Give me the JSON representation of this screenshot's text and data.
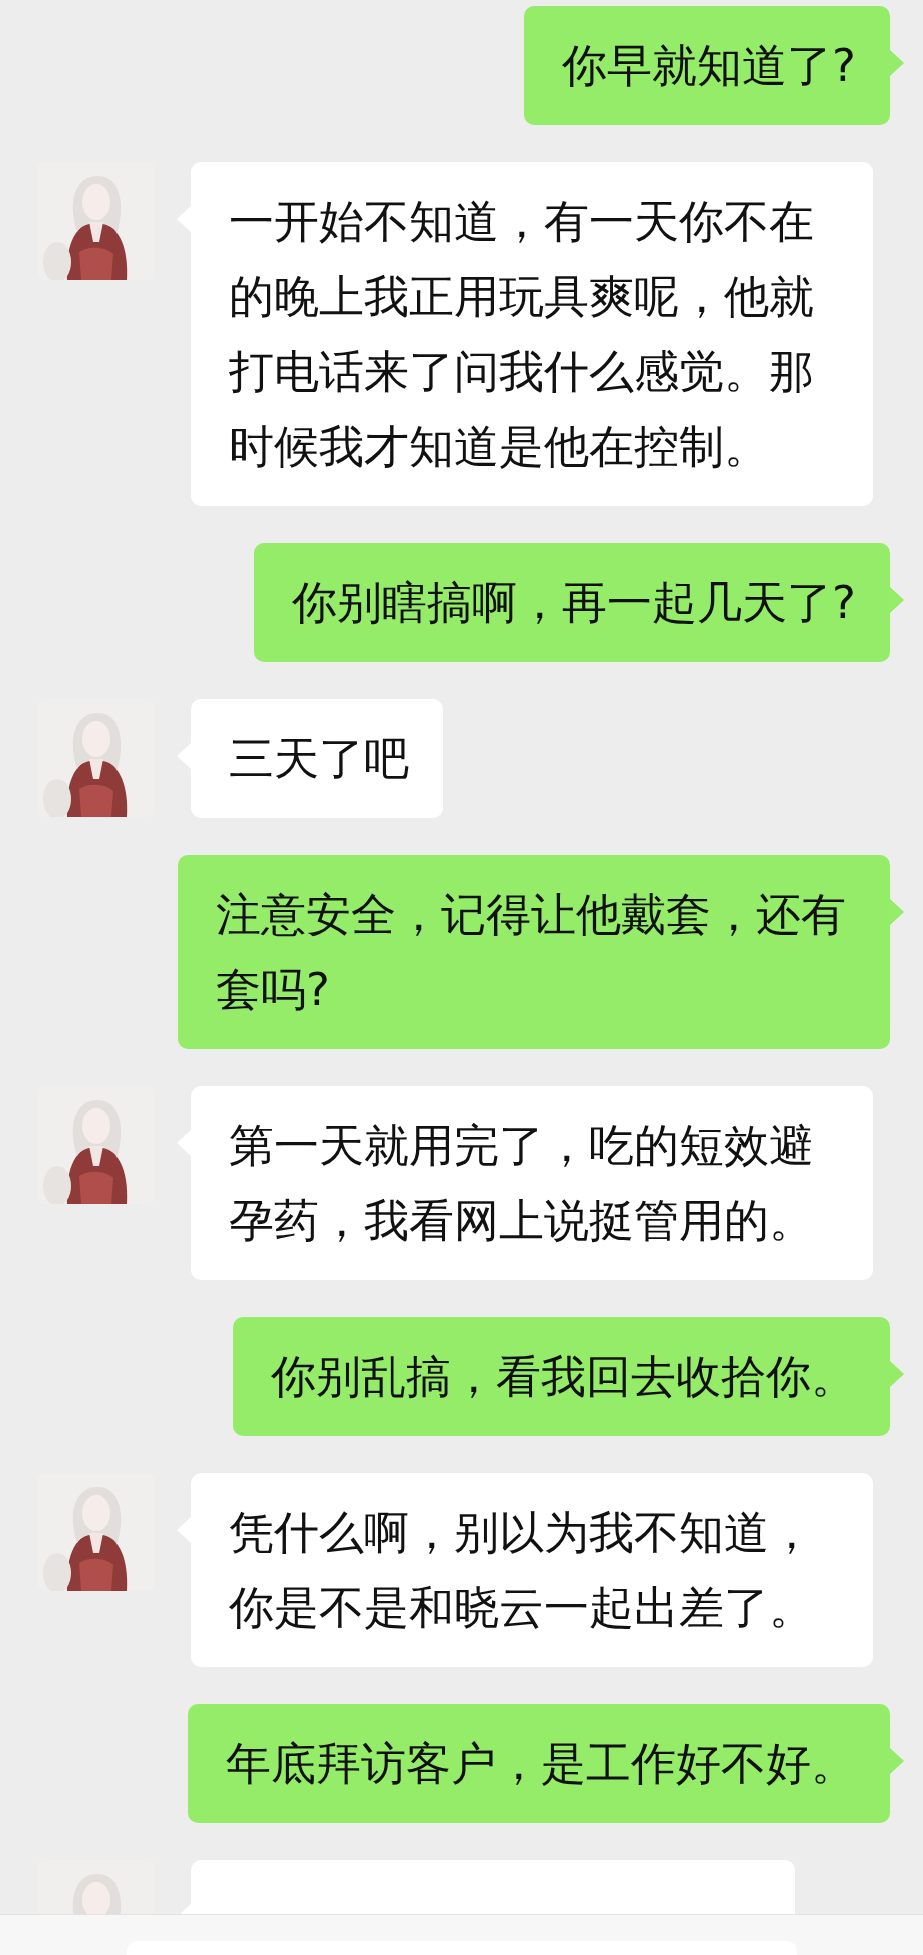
{
  "messages": [
    {
      "kind": "sent",
      "text": "你早就知道了?"
    },
    {
      "kind": "received",
      "text": "一开始不知道，有一天你不在的晚上我正用玩具爽呢，他就打电话来了问我什么感觉。那时候我才知道是他在控制。"
    },
    {
      "kind": "sent",
      "text": "你别瞎搞啊，再一起几天了?"
    },
    {
      "kind": "received",
      "text": "三天了吧"
    },
    {
      "kind": "sent",
      "text": "注意安全，记得让他戴套，还有套吗?"
    },
    {
      "kind": "received",
      "text": "第一天就用完了，吃的短效避孕药，我看网上说挺管用的。"
    },
    {
      "kind": "sent",
      "text": "你别乱搞，看我回去收拾你。"
    },
    {
      "kind": "received",
      "text": "凭什么啊，别以为我不知道，你是不是和晓云一起出差了。"
    },
    {
      "kind": "sent",
      "text": "年底拜访客户，是工作好不好。"
    },
    {
      "kind": "received-cut"
    }
  ]
}
